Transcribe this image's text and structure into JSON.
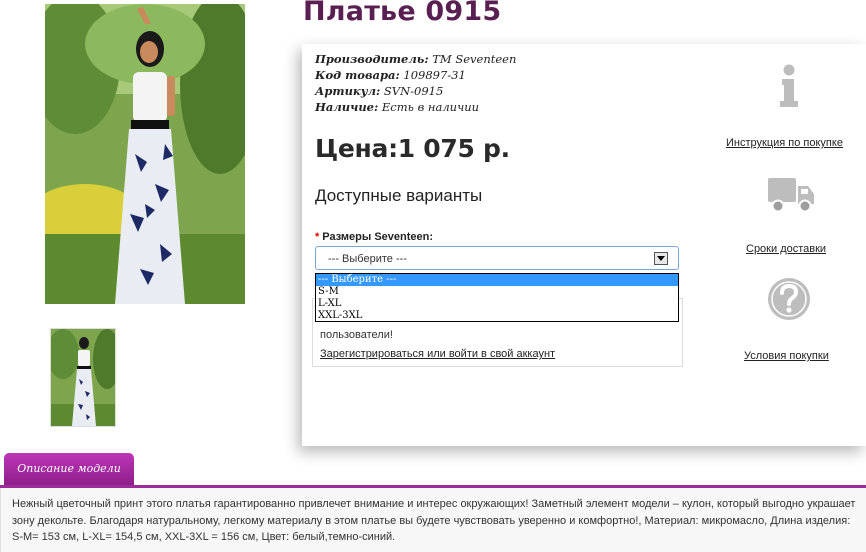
{
  "product": {
    "title": "Платье 0915",
    "manufacturer_label": "Производитель:",
    "manufacturer": "TM Seventeen",
    "code_label": "Код товара:",
    "code": "109897-31",
    "article_label": "Артикул:",
    "article": "SVN-0915",
    "availability_label": "Наличие:",
    "availability": "Есть в наличии",
    "price": "Цена:1 075 р."
  },
  "variants": {
    "title": "Доступные варианты",
    "required_mark": "*",
    "size_label": "Размеры Seventeen:",
    "selected": "--- Выберите ---",
    "options": [
      "--- Выберите ---",
      "S-M",
      "L-XL",
      "XXL-3XL"
    ],
    "highlighted_index": 0
  },
  "notice": {
    "text": "пользователи!",
    "link": "Зарегистрироваться или войти в свой аккаунт"
  },
  "side": {
    "instruction": "Инструкция по покупке",
    "delivery": "Сроки доставки",
    "terms": "Условия покупки"
  },
  "description": {
    "tab_label": "Описание модели",
    "text": "Нежный цветочный принт этого платья гарантированно привлечет внимание и интерес окружающих! Заметный элемент модели – кулон, который выгодно украшает зону декольте. Благодаря натуральному, легкому материалу в этом платье вы будете чувствовать уверенно и комфортно!, Материал: микромасло, Длина изделия: S-M= 153 см, L-XL= 154,5 см, XXL-3XL = 156 см, Цвет: белый,темно-синий."
  },
  "colors": {
    "title": "#5a1f52",
    "tab": "#9e2a9b",
    "select_border": "#7aa6d6",
    "highlight": "#3399ff",
    "required": "#e00000"
  },
  "icons": [
    "info-icon",
    "truck-icon",
    "question-icon",
    "dropdown-arrow-icon"
  ]
}
